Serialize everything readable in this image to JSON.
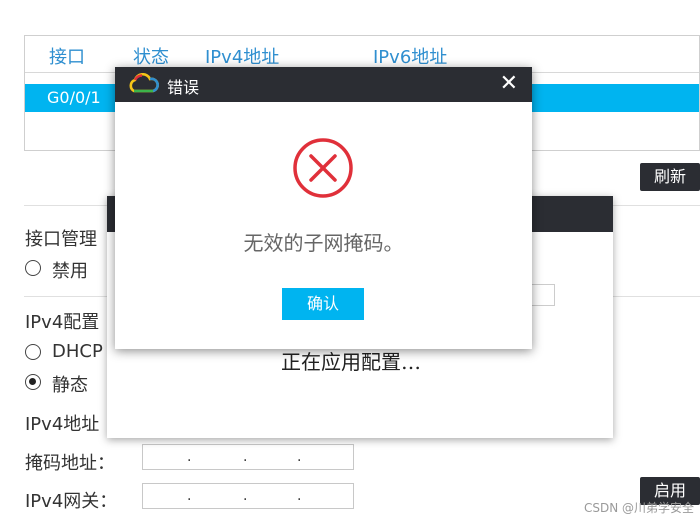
{
  "table": {
    "headers": [
      "接口",
      "状态",
      "IPv4地址",
      "IPv6地址"
    ],
    "rows": [
      {
        "name": "G0/0/1"
      }
    ]
  },
  "buttons": {
    "refresh": "刷新",
    "enable": "启用"
  },
  "form": {
    "iface_mgmt_label": "接口管理",
    "disable_label": "禁用",
    "ipv4_config_label": "IPv4配置",
    "dhcp_label": "DHCP",
    "static_label": "静态",
    "ipv4_addr_label": "IPv4地址",
    "mask_label": "掩码地址：",
    "gateway_label": "IPv4网关：",
    "ip_dots": "."
  },
  "progress_dialog": {
    "message": "正在应用配置…"
  },
  "error_dialog": {
    "title": "错误",
    "close": "✕",
    "message": "无效的子网掩码。",
    "ok_label": "确认",
    "icon_color": "#e0303a"
  },
  "watermark": "CSDN @川弟学安全",
  "colors": {
    "accent": "#00b4f0",
    "dark": "#2b2d33",
    "header_text": "#2f8fd0"
  }
}
